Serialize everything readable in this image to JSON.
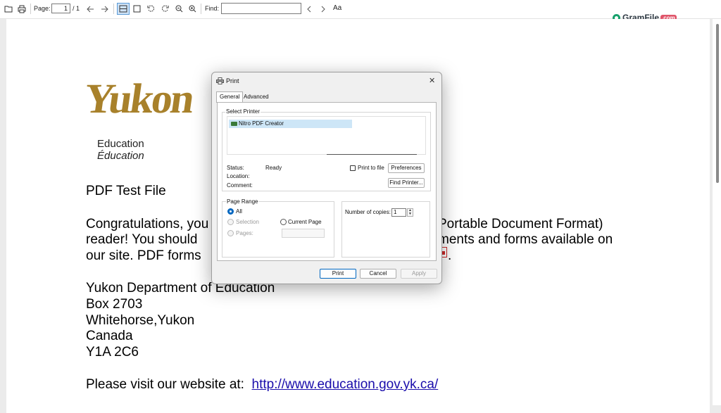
{
  "toolbar": {
    "page_label": "Page:",
    "page_value": "1",
    "page_total": "/ 1",
    "find_label": "Find:",
    "find_value": "",
    "text_options_label": "Aa"
  },
  "watermark": {
    "brand": "GramFile",
    "suffix": ".com"
  },
  "document": {
    "logo_text": "Yukon",
    "logo_color": "#a8812b",
    "education_en": "Education",
    "education_fr": "Éducation",
    "title": "PDF Test File",
    "paragraph_line1_left": "Congratulations, you",
    "paragraph_line1_right": "Portable Document Format)",
    "paragraph_line2_left": "reader!  You should",
    "paragraph_line2_right": "ments and forms available on",
    "paragraph_line3_left": "our site.  PDF forms",
    "paragraph_line3_right": ".",
    "address_line1": "Yukon Department of Education",
    "address_line2": "Box 2703",
    "address_line3": "Whitehorse,Yukon",
    "address_line4": "Canada",
    "address_line5": "Y1A 2C6",
    "website_prefix": "Please visit our website at:",
    "website_url": "http://www.education.gov.yk.ca/"
  },
  "print_dialog": {
    "title": "Print",
    "close": "✕",
    "tabs": [
      "General",
      "Advanced"
    ],
    "select_printer_label": "Select Printer",
    "printers": [
      "Nitro PDF Creator"
    ],
    "status_label": "Status:",
    "status_value": "Ready",
    "location_label": "Location:",
    "comment_label": "Comment:",
    "print_to_file_label": "Print to file",
    "preferences_button": "Preferences",
    "find_printer_button": "Find Printer...",
    "page_range_label": "Page Range",
    "range_all": "All",
    "range_selection": "Selection",
    "range_current_page": "Current Page",
    "range_pages": "Pages:",
    "copies_label": "Number of copies:",
    "copies_value": "1",
    "print_button": "Print",
    "cancel_button": "Cancel",
    "apply_button": "Apply"
  }
}
